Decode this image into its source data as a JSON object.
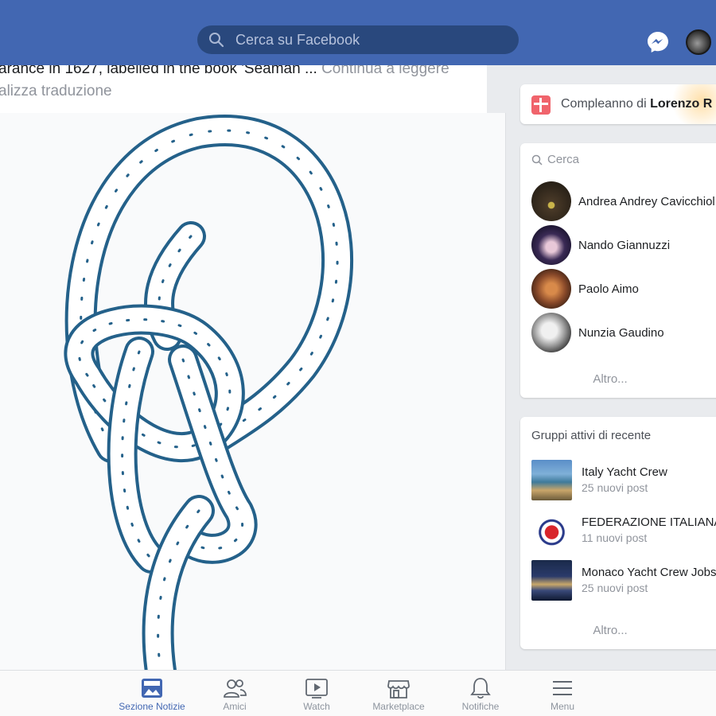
{
  "header": {
    "search_placeholder": "Cerca su Facebook",
    "icons": [
      "search-icon",
      "messenger-icon",
      "profile-avatar"
    ]
  },
  "post": {
    "text": "arance in 1627, labelled in the book 'Seaman ...",
    "see_more": "Continua a leggere",
    "translate": "alizza traduzione",
    "image_subject": "bowline-knot-rope-illustration",
    "rope_color": "#24618a"
  },
  "birthday": {
    "prefix": "Compleanno di ",
    "name": "Lorenzo R"
  },
  "contacts": {
    "search_placeholder": "Cerca",
    "items": [
      {
        "name": "Andrea Andrey Cavicchiol"
      },
      {
        "name": "Nando Giannuzzi"
      },
      {
        "name": "Paolo Aimo"
      },
      {
        "name": "Nunzia Gaudino"
      }
    ],
    "more": "Altro..."
  },
  "groups": {
    "title": "Gruppi attivi di recente",
    "items": [
      {
        "name": "Italy Yacht Crew",
        "posts": "25 nuovi post"
      },
      {
        "name": "FEDERAZIONE ITALIANA",
        "posts": "11 nuovi post"
      },
      {
        "name": "Monaco Yacht Crew Jobs",
        "posts": "25 nuovi post"
      }
    ],
    "more": "Altro..."
  },
  "tabbar": {
    "items": [
      {
        "label": "Sezione Notizie",
        "icon": "news-feed-icon",
        "active": true
      },
      {
        "label": "Amici",
        "icon": "friends-icon",
        "active": false
      },
      {
        "label": "Watch",
        "icon": "watch-icon",
        "active": false
      },
      {
        "label": "Marketplace",
        "icon": "marketplace-icon",
        "active": false
      },
      {
        "label": "Notifiche",
        "icon": "bell-icon",
        "active": false
      },
      {
        "label": "Menu",
        "icon": "menu-icon",
        "active": false
      }
    ]
  },
  "colors": {
    "brand_blue": "#4267b2",
    "search_bg": "#29487d",
    "muted_text": "#90949c"
  }
}
